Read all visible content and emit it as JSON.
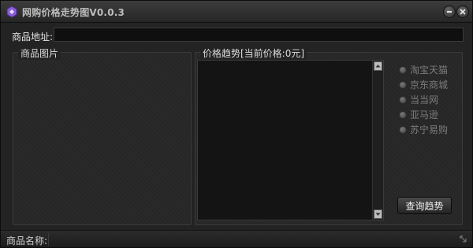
{
  "window": {
    "title": "网购价格走势图V0.0.3",
    "minimize_icon": "minimize-icon",
    "close_icon": "close-icon",
    "app_icon": "app-logo-icon"
  },
  "url_field": {
    "label": "商品地址:",
    "value": "",
    "placeholder": ""
  },
  "image_panel": {
    "title": "商品图片"
  },
  "trend_panel": {
    "title": "价格趋势[当前价格:0元]",
    "stores": [
      {
        "label": "淘宝天猫",
        "selected": false
      },
      {
        "label": "京东商城",
        "selected": false
      },
      {
        "label": "当当网",
        "selected": false
      },
      {
        "label": "亚马逊",
        "selected": false
      },
      {
        "label": "苏宁易购",
        "selected": false
      }
    ],
    "query_button": "查询趋势"
  },
  "status_bar": {
    "label": "商品名称:",
    "value": ""
  },
  "colors": {
    "window_bg": "#232323",
    "input_bg": "#0f0f0f",
    "accent_icon": "#8a5cd6"
  }
}
